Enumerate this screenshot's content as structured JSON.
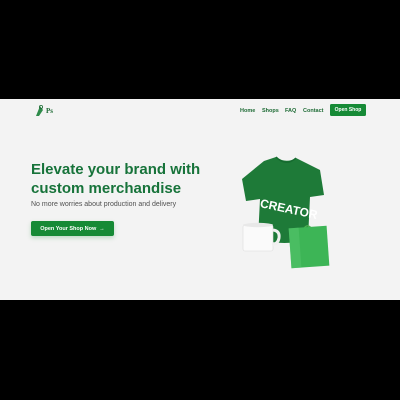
{
  "logo": {
    "text": "Ps"
  },
  "nav": {
    "items": [
      "Home",
      "Shops",
      "FAQ",
      "Contact"
    ],
    "cta": "Open Shop"
  },
  "hero": {
    "title": "Elevate your brand with custom merchandise",
    "subtitle": "No more worries about production and delivery",
    "cta": "Open Your Shop Now",
    "cta_arrow": "→",
    "shirt_text": "CREATOR"
  },
  "colors": {
    "brand_green": "#168a36",
    "heading_green": "#17733a",
    "background": "#f3f3f3"
  }
}
